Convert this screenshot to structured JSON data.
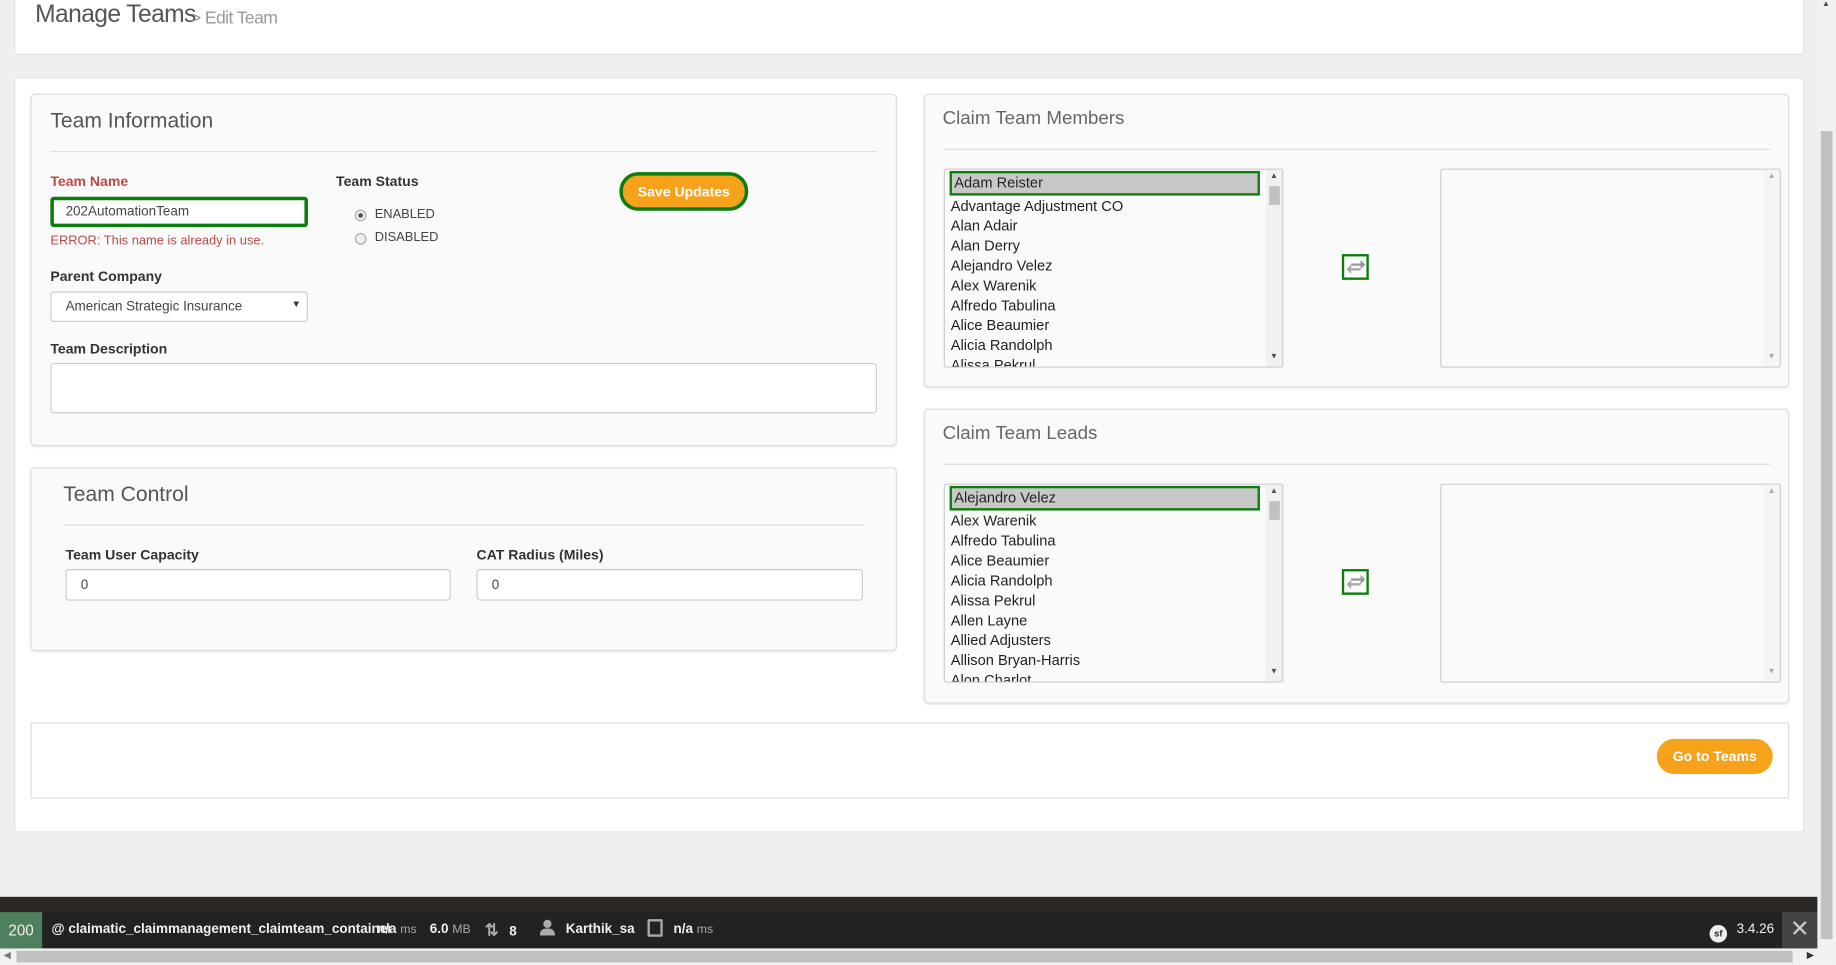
{
  "header": {
    "title": "Manage Teams",
    "breadcrumb": "> Edit Team"
  },
  "team_info": {
    "title": "Team Information",
    "team_name_label": "Team Name",
    "team_name_value": "202AutomationTeam",
    "team_name_error": "ERROR: This name is already in use.",
    "status_label": "Team Status",
    "status_options": [
      {
        "label": "ENABLED",
        "checked": true
      },
      {
        "label": "DISABLED",
        "checked": false
      }
    ],
    "save_button": "Save Updates",
    "parent_company_label": "Parent Company",
    "parent_company_value": "American Strategic Insurance",
    "description_label": "Team Description",
    "description_value": ""
  },
  "team_control": {
    "title": "Team Control",
    "capacity_label": "Team User Capacity",
    "capacity_value": "0",
    "radius_label": "CAT Radius (Miles)",
    "radius_value": "0"
  },
  "members": {
    "title": "Claim Team Members",
    "available": [
      "Adam Reister",
      "Advantage Adjustment CO",
      "Alan Adair",
      "Alan Derry",
      "Alejandro Velez",
      "Alex Warenik",
      "Alfredo Tabulina",
      "Alice Beaumier",
      "Alicia Randolph",
      "Alissa Pekrul"
    ],
    "selected": []
  },
  "leads": {
    "title": "Claim Team Leads",
    "available": [
      "Alejandro Velez",
      "Alex Warenik",
      "Alfredo Tabulina",
      "Alice Beaumier",
      "Alicia Randolph",
      "Alissa Pekrul",
      "Allen Layne",
      "Allied Adjusters",
      "Allison Bryan-Harris",
      "Alon Charlot"
    ],
    "selected": []
  },
  "footer": {
    "go_to_teams": "Go to Teams"
  },
  "debug_bar": {
    "status": "200",
    "route": "@ claimatic_claimmanagement_claimteam_container",
    "time": "n/a",
    "time_unit": "ms",
    "memory": "6.0",
    "memory_unit": "MB",
    "requests": "8",
    "user": "Karthik_sa",
    "db_time": "n/a",
    "db_unit": "ms",
    "version": "3.4.26"
  },
  "colors": {
    "accent": "#f7a21b",
    "focus": "#0a7d0a",
    "error": "#b94a48",
    "status_ok": "#4f805d"
  }
}
